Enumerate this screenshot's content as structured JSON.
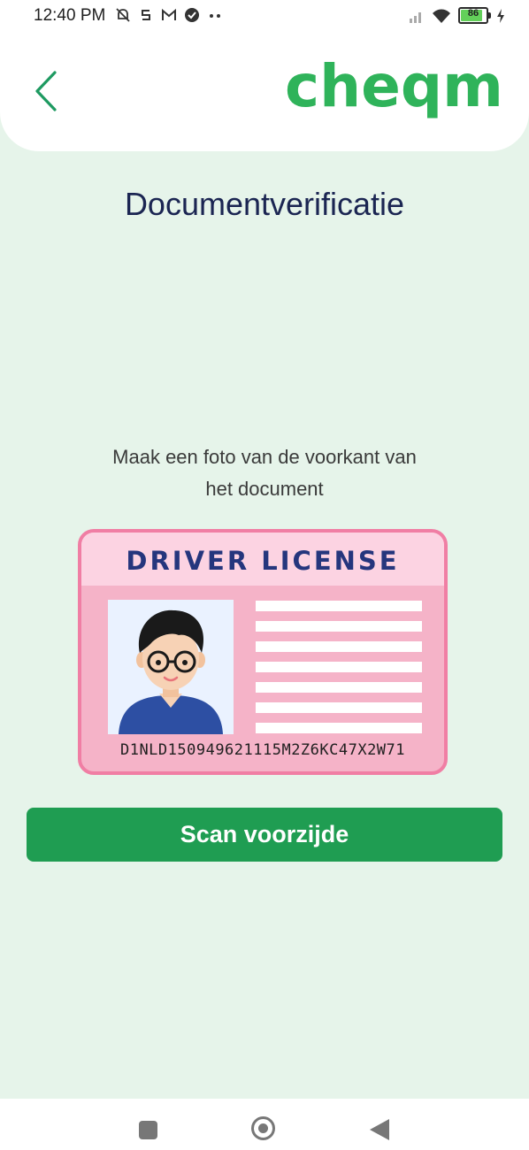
{
  "status_bar": {
    "time": "12:40 PM",
    "battery_level": "86",
    "battery_percent": 86,
    "icons_left": [
      "notifications-off-icon",
      "s-app-icon",
      "gmail-icon",
      "check-circle-icon",
      "more-dots-icon"
    ],
    "icons_right": [
      "signal-icon",
      "wifi-icon",
      "battery-icon",
      "charging-icon"
    ]
  },
  "header": {
    "logo_text": "cheqm",
    "logo_color": "#2fb35a",
    "back_icon": "chevron-left-icon"
  },
  "page": {
    "title": "Documentverificatie",
    "instruction_line1": "Maak een foto van de voorkant van",
    "instruction_line2": "het document"
  },
  "license_card": {
    "header": "DRIVER LICENSE",
    "number": "D1NLD150949621115M2Z6KC47X2W71",
    "text_lines": 7
  },
  "actions": {
    "scan_label": "Scan voorzijde"
  },
  "nav_bar": {
    "icons": [
      "recent-apps-icon",
      "home-icon",
      "back-icon"
    ]
  },
  "colors": {
    "background": "#e6f4ea",
    "primary": "#1f9d52",
    "title": "#1b2552",
    "card_border": "#f07ea4",
    "card_fill": "#f5b3c8"
  }
}
